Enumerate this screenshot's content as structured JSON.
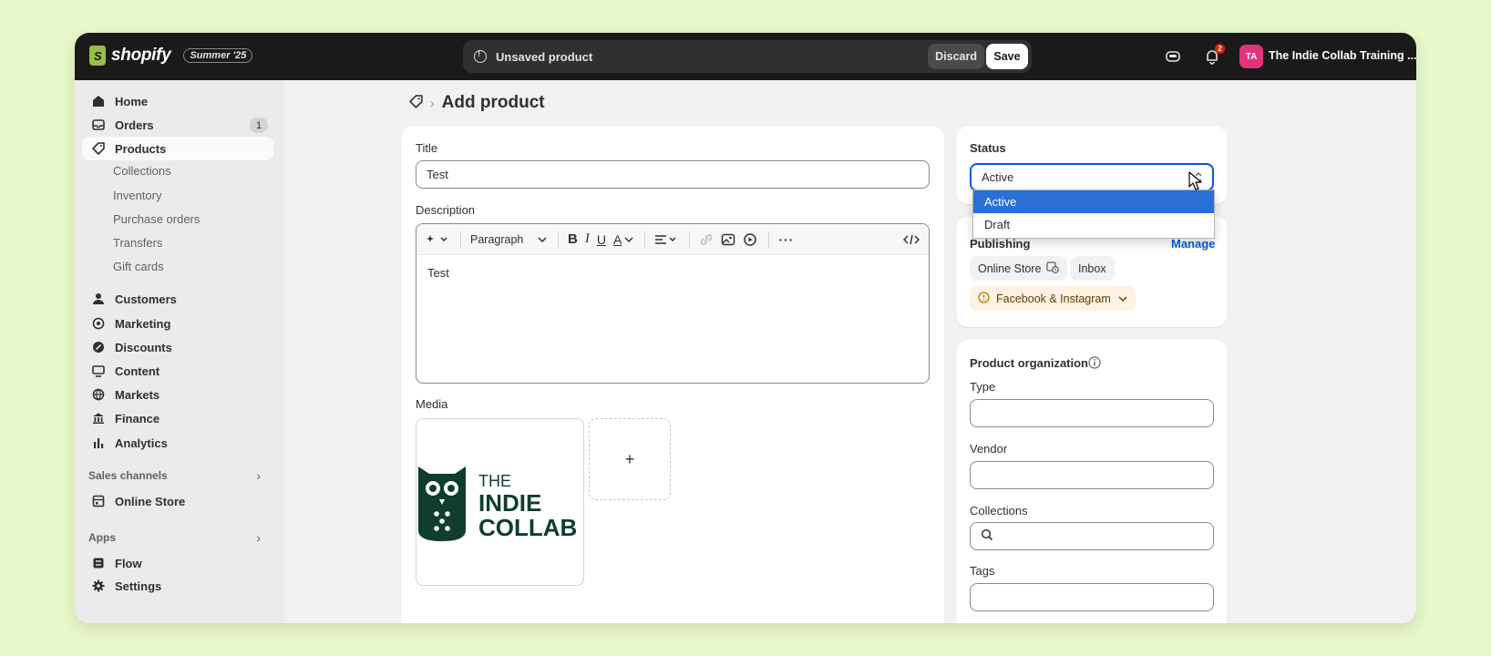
{
  "topbar": {
    "logo_text": "shopify",
    "edition_badge": "Summer '25",
    "savebar_message": "Unsaved product",
    "discard_label": "Discard",
    "save_label": "Save",
    "notification_count": "2",
    "avatar_initials": "TA",
    "store_name": "The Indie Collab Training ...",
    "colors": {
      "bar": "#1a1a1a",
      "avatar": "#e0337a",
      "badge": "#e51c00"
    }
  },
  "sidebar": {
    "items": [
      {
        "label": "Home",
        "icon": "home-icon"
      },
      {
        "label": "Orders",
        "icon": "inbox-icon",
        "count": "1"
      },
      {
        "label": "Products",
        "icon": "tag-icon",
        "active": true
      },
      {
        "label": "Customers",
        "icon": "person-icon"
      },
      {
        "label": "Marketing",
        "icon": "target-icon"
      },
      {
        "label": "Discounts",
        "icon": "discount-icon"
      },
      {
        "label": "Content",
        "icon": "content-icon"
      },
      {
        "label": "Markets",
        "icon": "globe-icon"
      },
      {
        "label": "Finance",
        "icon": "bank-icon"
      },
      {
        "label": "Analytics",
        "icon": "chart-icon"
      }
    ],
    "product_subitems": [
      "Collections",
      "Inventory",
      "Purchase orders",
      "Transfers",
      "Gift cards"
    ],
    "sales_channels_label": "Sales channels",
    "online_store_label": "Online Store",
    "apps_label": "Apps",
    "flow_label": "Flow",
    "settings_label": "Settings"
  },
  "page": {
    "title": "Add product"
  },
  "product": {
    "title_label": "Title",
    "title_value": "Test",
    "description_label": "Description",
    "paragraph_label": "Paragraph",
    "description_value": "Test",
    "media_label": "Media",
    "media_add": "+",
    "logo_line1": "THE",
    "logo_line2": "INDIE",
    "logo_line3": "COLLAB"
  },
  "status": {
    "label": "Status",
    "value": "Active",
    "options": [
      "Active",
      "Draft"
    ]
  },
  "publishing": {
    "label": "Publishing",
    "manage_label": "Manage",
    "channels": [
      "Online Store",
      "Inbox",
      "Facebook & Instagram"
    ]
  },
  "organization": {
    "label": "Product organization",
    "type_label": "Type",
    "vendor_label": "Vendor",
    "collections_label": "Collections",
    "tags_label": "Tags"
  }
}
